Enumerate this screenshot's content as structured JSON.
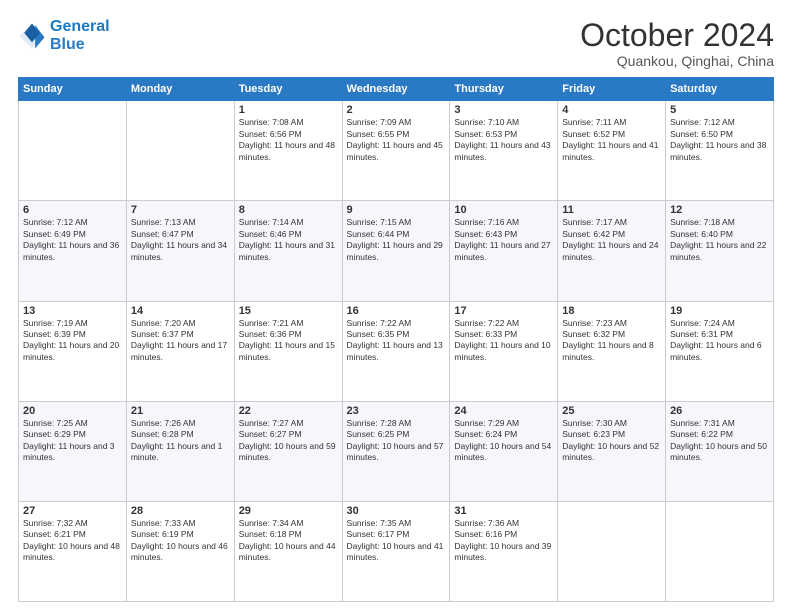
{
  "header": {
    "logo_line1": "General",
    "logo_line2": "Blue",
    "title": "October 2024",
    "subtitle": "Quankou, Qinghai, China"
  },
  "weekdays": [
    "Sunday",
    "Monday",
    "Tuesday",
    "Wednesday",
    "Thursday",
    "Friday",
    "Saturday"
  ],
  "weeks": [
    [
      {
        "day": "",
        "sunrise": "",
        "sunset": "",
        "daylight": ""
      },
      {
        "day": "",
        "sunrise": "",
        "sunset": "",
        "daylight": ""
      },
      {
        "day": "1",
        "sunrise": "Sunrise: 7:08 AM",
        "sunset": "Sunset: 6:56 PM",
        "daylight": "Daylight: 11 hours and 48 minutes."
      },
      {
        "day": "2",
        "sunrise": "Sunrise: 7:09 AM",
        "sunset": "Sunset: 6:55 PM",
        "daylight": "Daylight: 11 hours and 45 minutes."
      },
      {
        "day": "3",
        "sunrise": "Sunrise: 7:10 AM",
        "sunset": "Sunset: 6:53 PM",
        "daylight": "Daylight: 11 hours and 43 minutes."
      },
      {
        "day": "4",
        "sunrise": "Sunrise: 7:11 AM",
        "sunset": "Sunset: 6:52 PM",
        "daylight": "Daylight: 11 hours and 41 minutes."
      },
      {
        "day": "5",
        "sunrise": "Sunrise: 7:12 AM",
        "sunset": "Sunset: 6:50 PM",
        "daylight": "Daylight: 11 hours and 38 minutes."
      }
    ],
    [
      {
        "day": "6",
        "sunrise": "Sunrise: 7:12 AM",
        "sunset": "Sunset: 6:49 PM",
        "daylight": "Daylight: 11 hours and 36 minutes."
      },
      {
        "day": "7",
        "sunrise": "Sunrise: 7:13 AM",
        "sunset": "Sunset: 6:47 PM",
        "daylight": "Daylight: 11 hours and 34 minutes."
      },
      {
        "day": "8",
        "sunrise": "Sunrise: 7:14 AM",
        "sunset": "Sunset: 6:46 PM",
        "daylight": "Daylight: 11 hours and 31 minutes."
      },
      {
        "day": "9",
        "sunrise": "Sunrise: 7:15 AM",
        "sunset": "Sunset: 6:44 PM",
        "daylight": "Daylight: 11 hours and 29 minutes."
      },
      {
        "day": "10",
        "sunrise": "Sunrise: 7:16 AM",
        "sunset": "Sunset: 6:43 PM",
        "daylight": "Daylight: 11 hours and 27 minutes."
      },
      {
        "day": "11",
        "sunrise": "Sunrise: 7:17 AM",
        "sunset": "Sunset: 6:42 PM",
        "daylight": "Daylight: 11 hours and 24 minutes."
      },
      {
        "day": "12",
        "sunrise": "Sunrise: 7:18 AM",
        "sunset": "Sunset: 6:40 PM",
        "daylight": "Daylight: 11 hours and 22 minutes."
      }
    ],
    [
      {
        "day": "13",
        "sunrise": "Sunrise: 7:19 AM",
        "sunset": "Sunset: 6:39 PM",
        "daylight": "Daylight: 11 hours and 20 minutes."
      },
      {
        "day": "14",
        "sunrise": "Sunrise: 7:20 AM",
        "sunset": "Sunset: 6:37 PM",
        "daylight": "Daylight: 11 hours and 17 minutes."
      },
      {
        "day": "15",
        "sunrise": "Sunrise: 7:21 AM",
        "sunset": "Sunset: 6:36 PM",
        "daylight": "Daylight: 11 hours and 15 minutes."
      },
      {
        "day": "16",
        "sunrise": "Sunrise: 7:22 AM",
        "sunset": "Sunset: 6:35 PM",
        "daylight": "Daylight: 11 hours and 13 minutes."
      },
      {
        "day": "17",
        "sunrise": "Sunrise: 7:22 AM",
        "sunset": "Sunset: 6:33 PM",
        "daylight": "Daylight: 11 hours and 10 minutes."
      },
      {
        "day": "18",
        "sunrise": "Sunrise: 7:23 AM",
        "sunset": "Sunset: 6:32 PM",
        "daylight": "Daylight: 11 hours and 8 minutes."
      },
      {
        "day": "19",
        "sunrise": "Sunrise: 7:24 AM",
        "sunset": "Sunset: 6:31 PM",
        "daylight": "Daylight: 11 hours and 6 minutes."
      }
    ],
    [
      {
        "day": "20",
        "sunrise": "Sunrise: 7:25 AM",
        "sunset": "Sunset: 6:29 PM",
        "daylight": "Daylight: 11 hours and 3 minutes."
      },
      {
        "day": "21",
        "sunrise": "Sunrise: 7:26 AM",
        "sunset": "Sunset: 6:28 PM",
        "daylight": "Daylight: 11 hours and 1 minute."
      },
      {
        "day": "22",
        "sunrise": "Sunrise: 7:27 AM",
        "sunset": "Sunset: 6:27 PM",
        "daylight": "Daylight: 10 hours and 59 minutes."
      },
      {
        "day": "23",
        "sunrise": "Sunrise: 7:28 AM",
        "sunset": "Sunset: 6:25 PM",
        "daylight": "Daylight: 10 hours and 57 minutes."
      },
      {
        "day": "24",
        "sunrise": "Sunrise: 7:29 AM",
        "sunset": "Sunset: 6:24 PM",
        "daylight": "Daylight: 10 hours and 54 minutes."
      },
      {
        "day": "25",
        "sunrise": "Sunrise: 7:30 AM",
        "sunset": "Sunset: 6:23 PM",
        "daylight": "Daylight: 10 hours and 52 minutes."
      },
      {
        "day": "26",
        "sunrise": "Sunrise: 7:31 AM",
        "sunset": "Sunset: 6:22 PM",
        "daylight": "Daylight: 10 hours and 50 minutes."
      }
    ],
    [
      {
        "day": "27",
        "sunrise": "Sunrise: 7:32 AM",
        "sunset": "Sunset: 6:21 PM",
        "daylight": "Daylight: 10 hours and 48 minutes."
      },
      {
        "day": "28",
        "sunrise": "Sunrise: 7:33 AM",
        "sunset": "Sunset: 6:19 PM",
        "daylight": "Daylight: 10 hours and 46 minutes."
      },
      {
        "day": "29",
        "sunrise": "Sunrise: 7:34 AM",
        "sunset": "Sunset: 6:18 PM",
        "daylight": "Daylight: 10 hours and 44 minutes."
      },
      {
        "day": "30",
        "sunrise": "Sunrise: 7:35 AM",
        "sunset": "Sunset: 6:17 PM",
        "daylight": "Daylight: 10 hours and 41 minutes."
      },
      {
        "day": "31",
        "sunrise": "Sunrise: 7:36 AM",
        "sunset": "Sunset: 6:16 PM",
        "daylight": "Daylight: 10 hours and 39 minutes."
      },
      {
        "day": "",
        "sunrise": "",
        "sunset": "",
        "daylight": ""
      },
      {
        "day": "",
        "sunrise": "",
        "sunset": "",
        "daylight": ""
      }
    ]
  ]
}
